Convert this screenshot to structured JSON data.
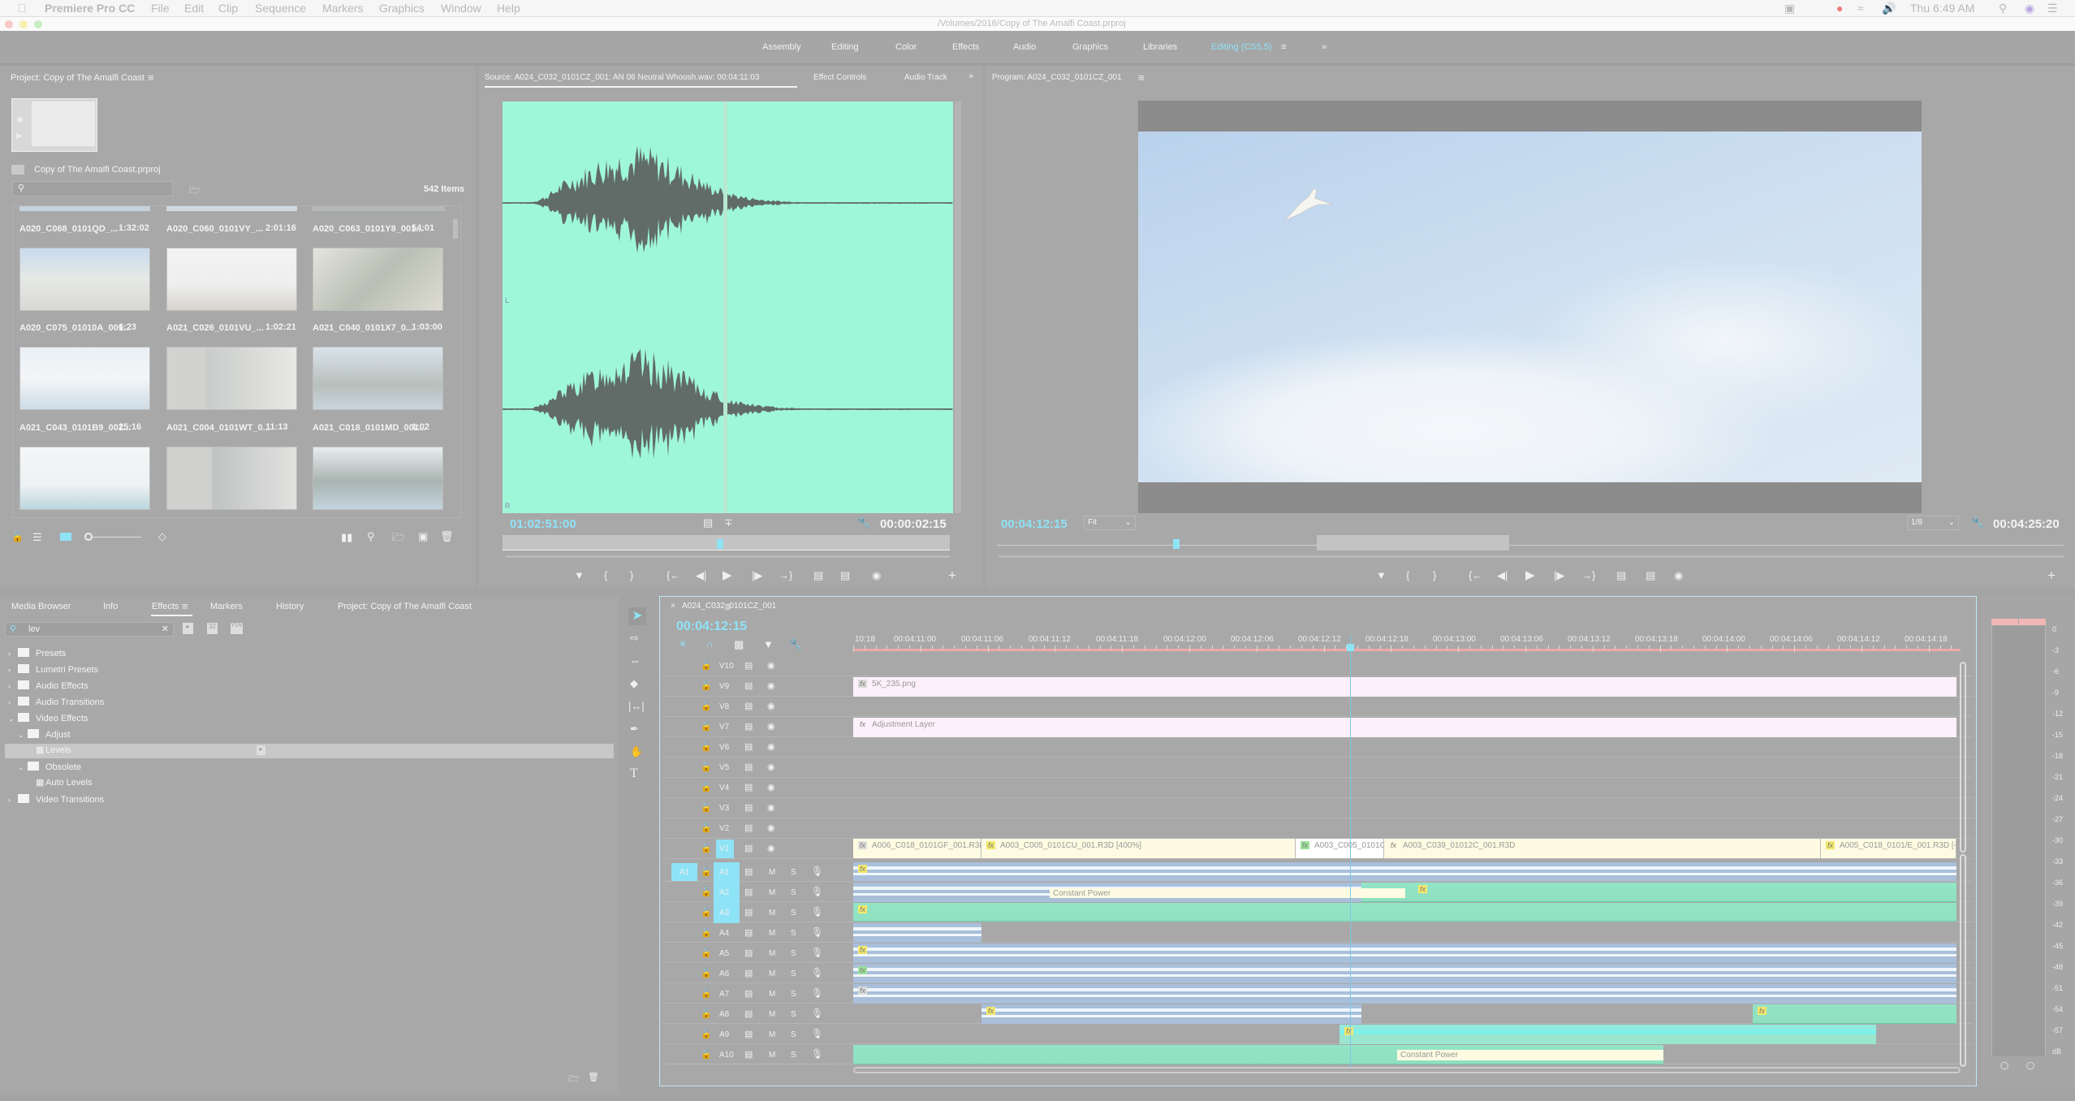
{
  "menubar": {
    "app": "Premiere Pro CC",
    "items": [
      "File",
      "Edit",
      "Clip",
      "Sequence",
      "Markers",
      "Graphics",
      "Window",
      "Help"
    ],
    "clock": "Thu 6:49 AM"
  },
  "titlebar": {
    "path": "/Volumes/2016/Copy of The Amalfi Coast.prproj"
  },
  "workspaces": {
    "items": [
      "Assembly",
      "Editing",
      "Color",
      "Effects",
      "Audio",
      "Graphics",
      "Libraries",
      "Editing (CS5.5)"
    ],
    "active": "Editing (CS5.5)",
    "more": "»"
  },
  "project": {
    "title": "Project: Copy of The Amalfi Coast",
    "file": "Copy of The Amalfi Coast.prproj",
    "search_placeholder": "",
    "count": "542 Items",
    "clips": [
      {
        "name": "A020_C068_0101QD_...",
        "dur": "1:32:02"
      },
      {
        "name": "A020_C060_0101VY_...",
        "dur": "2:01:16"
      },
      {
        "name": "A020_C063_0101Y8_001...",
        "dur": "54:01"
      },
      {
        "name": "A020_C075_01010A_001...",
        "dur": "6:23"
      },
      {
        "name": "A021_C026_0101VU_...",
        "dur": "1:02:21"
      },
      {
        "name": "A021_C040_0101X7_0...",
        "dur": "1:03:00"
      },
      {
        "name": "A021_C043_0101B9_001...",
        "dur": "25:16"
      },
      {
        "name": "A021_C004_0101WT_0...",
        "dur": "11:13"
      },
      {
        "name": "A021_C018_0101MD_001...",
        "dur": "1:02"
      }
    ]
  },
  "source": {
    "tab": "Source: A024_C032_0101CZ_001: AN 06 Neutral Whoosh.wav: 00:04:11:03",
    "tabs": [
      "Effect Controls",
      "Audio Track"
    ],
    "more": "»",
    "timecode": "01:02:51:00",
    "duration": "00:00:02:15",
    "channel_labels": [
      "L",
      "R"
    ],
    "playhead_fraction": 0.49
  },
  "program": {
    "tab": "Program: A024_C032_0101CZ_001",
    "timecode": "00:04:12:15",
    "fit": "Fit",
    "resolution": "1/8",
    "duration": "00:04:25:20"
  },
  "effects_panel": {
    "tabs": [
      "Media Browser",
      "Info",
      "Effects",
      "Markers",
      "History",
      "Project: Copy of The Amalfi Coast"
    ],
    "active": "Effects",
    "search_value": "lev",
    "badges": [
      "accel",
      "32",
      "YUV"
    ],
    "tree": [
      {
        "label": "Presets",
        "indent": 0,
        "expanded": false,
        "type": "preset-folder"
      },
      {
        "label": "Lumetri Presets",
        "indent": 0,
        "expanded": false,
        "type": "preset-folder"
      },
      {
        "label": "Audio Effects",
        "indent": 0,
        "expanded": false,
        "type": "folder"
      },
      {
        "label": "Audio Transitions",
        "indent": 0,
        "expanded": false,
        "type": "folder"
      },
      {
        "label": "Video Effects",
        "indent": 0,
        "expanded": true,
        "type": "folder"
      },
      {
        "label": "Adjust",
        "indent": 1,
        "expanded": true,
        "type": "folder"
      },
      {
        "label": "Levels",
        "indent": 2,
        "type": "effect",
        "selected": true
      },
      {
        "label": "Obsolete",
        "indent": 1,
        "expanded": true,
        "type": "folder"
      },
      {
        "label": "Auto Levels",
        "indent": 2,
        "type": "effect"
      },
      {
        "label": "Video Transitions",
        "indent": 0,
        "expanded": false,
        "type": "folder"
      }
    ]
  },
  "timeline": {
    "sequence": "A024_C032_0101CZ_001",
    "timecode": "00:04:12:15",
    "ruler": [
      "10:18",
      "00:04:11:00",
      "00:04:11:06",
      "00:04:11:12",
      "00:04:11:18",
      "00:04:12:00",
      "00:04:12:06",
      "00:04:12:12",
      "00:04:12:18",
      "00:04:13:00",
      "00:04:13:06",
      "00:04:13:12",
      "00:04:13:18",
      "00:04:14:00",
      "00:04:14:06",
      "00:04:14:12",
      "00:04:14:18"
    ],
    "video_tracks": [
      "V10",
      "V9",
      "V8",
      "V7",
      "V6",
      "V5",
      "V4",
      "V3",
      "V2",
      "V1"
    ],
    "audio_tracks": [
      "A1",
      "A2",
      "A3",
      "A4",
      "A5",
      "A6",
      "A7",
      "A8",
      "A9",
      "A10"
    ],
    "source_patch": "A1",
    "mute": "M",
    "solo": "S",
    "clips": {
      "v9": "5K_235.png",
      "v7": "Adjustment Layer",
      "v1": [
        "A006_C018_0101GF_001.R3D",
        "A003_C005_0101CU_001.R3D [400%]",
        "A003_C005_0101CU",
        "A003_C039_01012C_001.R3D",
        "A005_C018_0101/E_001.R3D [-10"
      ],
      "transition": "Constant Power"
    }
  },
  "meter": {
    "scale": [
      "0",
      "-3",
      "-6",
      "-9",
      "-12",
      "-15",
      "-18",
      "-21",
      "-24",
      "-27",
      "-30",
      "-33",
      "-36",
      "-39",
      "-42",
      "-45",
      "-48",
      "-51",
      "-54",
      "-57",
      "dB"
    ]
  },
  "colors": {
    "accent": "#8fe3f7",
    "waveform_bg": "#9ff7d9",
    "video_clip": "#fdf0fa",
    "av_clip": "#fdfbe2",
    "audio_blue": "#a9bfda",
    "audio_green": "#93e4c6"
  }
}
